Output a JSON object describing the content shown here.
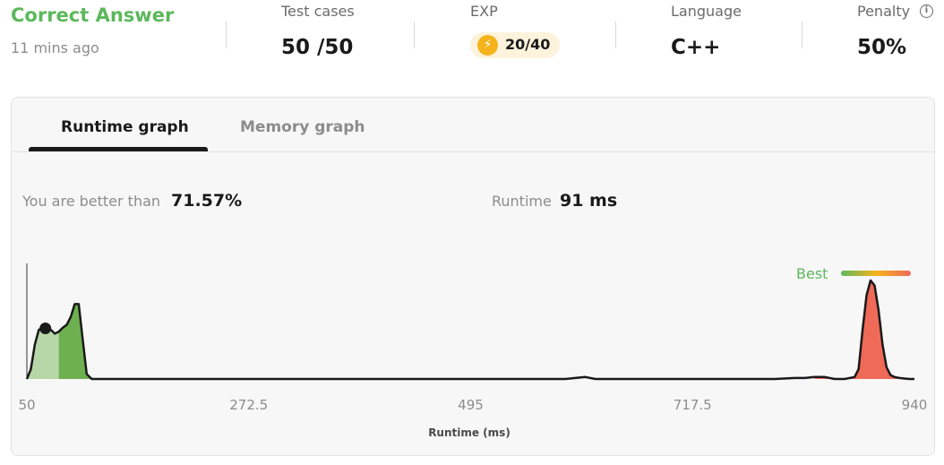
{
  "header": {
    "verdict": "Correct Answer",
    "submitted_ago": "11 mins ago",
    "test_cases": {
      "label": "Test cases",
      "value": "50 /50"
    },
    "exp": {
      "label": "EXP",
      "value": "20/40"
    },
    "language": {
      "label": "Language",
      "value": "C++"
    },
    "penalty": {
      "label": "Penalty",
      "value": "50%"
    }
  },
  "tabs": [
    {
      "label": "Runtime graph",
      "active": true
    },
    {
      "label": "Memory graph",
      "active": false
    }
  ],
  "summary": {
    "better_than_label": "You are better than",
    "better_than_value": "71.57%",
    "runtime_label": "Runtime",
    "runtime_value": "91 ms"
  },
  "legend": {
    "best_label": "Best"
  },
  "colors": {
    "accent_green": "#5cb85c",
    "best_red": "#ef6a57",
    "exp_gold": "#f5b31c"
  },
  "chart_data": {
    "type": "area",
    "xlabel": "Runtime (ms)",
    "xlim": [
      50,
      940
    ],
    "xticks": [
      "50",
      "272.5",
      "495",
      "717.5",
      "940"
    ],
    "x": [
      50,
      54,
      58,
      62,
      66,
      70,
      74,
      78,
      82,
      86,
      90,
      94,
      98,
      102,
      106,
      110,
      115,
      200,
      300,
      400,
      500,
      590,
      600,
      610,
      620,
      700,
      800,
      820,
      830,
      840,
      850,
      860,
      870,
      880,
      884,
      888,
      892,
      896,
      900,
      904,
      908,
      912,
      916,
      920,
      925,
      930,
      935,
      940
    ],
    "values": [
      0,
      0.1,
      0.35,
      0.5,
      0.51,
      0.52,
      0.5,
      0.46,
      0.48,
      0.52,
      0.55,
      0.63,
      0.76,
      0.76,
      0.4,
      0.05,
      0,
      0,
      0,
      0,
      0,
      0,
      0.01,
      0.02,
      0,
      0,
      0,
      0.01,
      0.01,
      0.02,
      0.02,
      0,
      0,
      0.02,
      0.1,
      0.5,
      0.85,
      1.0,
      0.95,
      0.7,
      0.35,
      0.12,
      0.04,
      0.02,
      0.01,
      0.005,
      0,
      0
    ],
    "marker_x": 91,
    "marker_y": 0.55
  }
}
